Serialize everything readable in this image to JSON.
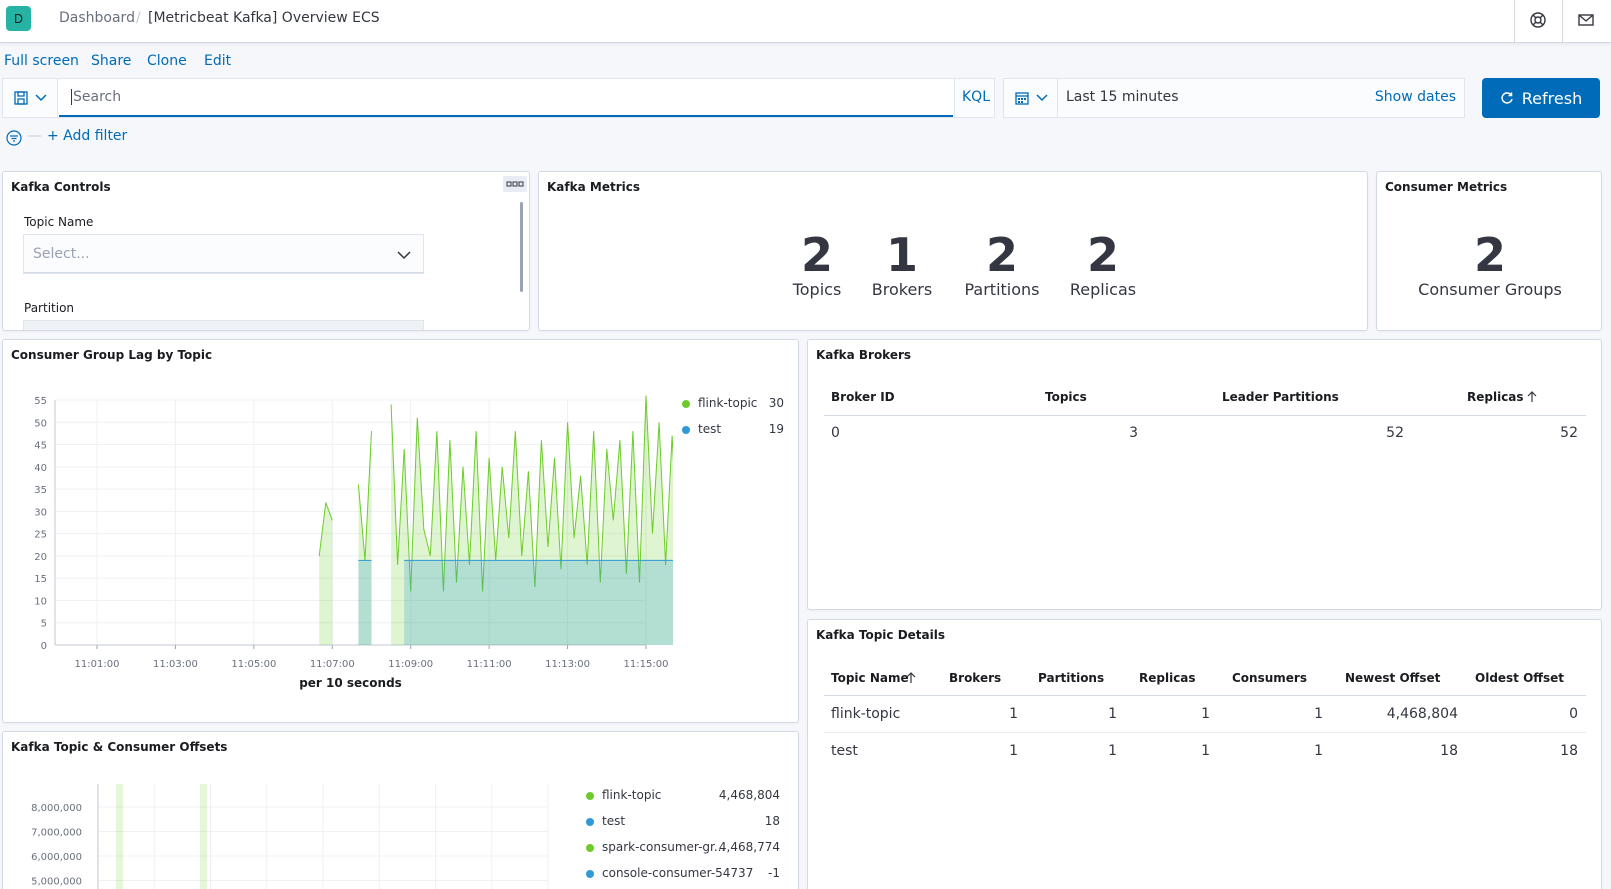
{
  "header": {
    "logo_letter": "D",
    "breadcrumb": [
      "Dashboard",
      "[Metricbeat Kafka] Overview ECS"
    ],
    "icons": [
      "help-icon",
      "mail-icon"
    ]
  },
  "menu": [
    "Full screen",
    "Share",
    "Clone",
    "Edit"
  ],
  "query": {
    "placeholder": "Search",
    "language": "KQL"
  },
  "time": {
    "range": "Last 15 minutes",
    "show_dates": "Show dates",
    "refresh": "Refresh"
  },
  "filter": {
    "add_filter": "+ Add filter"
  },
  "controls": {
    "title": "Kafka Controls",
    "topic_label": "Topic Name",
    "topic_placeholder": "Select...",
    "partition_label": "Partition"
  },
  "kafka_metrics": {
    "title": "Kafka Metrics",
    "items": [
      {
        "value": "2",
        "label": "Topics"
      },
      {
        "value": "1",
        "label": "Brokers"
      },
      {
        "value": "2",
        "label": "Partitions"
      },
      {
        "value": "2",
        "label": "Replicas"
      }
    ]
  },
  "consumer_metrics": {
    "title": "Consumer Metrics",
    "value": "2",
    "label": "Consumer Groups"
  },
  "lag_chart": {
    "title": "Consumer Group Lag by Topic",
    "xlabel": "per 10 seconds",
    "legend": [
      {
        "name": "flink-topic",
        "value": "30",
        "color": "#54b399"
      },
      {
        "name": "test",
        "value": "19",
        "color": "#6092c0"
      }
    ]
  },
  "chart_data": [
    {
      "type": "area",
      "title": "Consumer Group Lag by Topic",
      "xlabel": "per 10 seconds",
      "ylabel": "",
      "ylim": [
        0,
        55
      ],
      "yticks": [
        0,
        5,
        10,
        15,
        20,
        25,
        30,
        35,
        40,
        45,
        50,
        55
      ],
      "xticks": [
        "11:01:00",
        "11:03:00",
        "11:05:00",
        "11:07:00",
        "11:09:00",
        "11:11:00",
        "11:13:00",
        "11:15:00"
      ],
      "x_start_seconds_from_1100": 0,
      "x_step_seconds": 10,
      "series": [
        {
          "name": "flink-topic",
          "color": "#6dcc2b",
          "values": [
            null,
            null,
            null,
            null,
            null,
            null,
            null,
            null,
            null,
            null,
            null,
            null,
            null,
            null,
            null,
            null,
            null,
            null,
            null,
            null,
            null,
            null,
            null,
            null,
            null,
            null,
            null,
            null,
            null,
            null,
            null,
            null,
            null,
            null,
            null,
            null,
            null,
            null,
            null,
            null,
            20,
            32,
            28,
            null,
            null,
            null,
            36,
            19,
            48,
            null,
            null,
            54,
            18,
            44,
            12,
            51,
            26,
            20,
            48,
            12,
            46,
            14,
            40,
            18,
            48,
            12,
            42,
            19,
            40,
            24,
            48,
            20,
            39,
            13,
            46,
            22,
            42,
            17,
            50,
            24,
            38,
            18,
            48,
            14,
            44,
            28,
            46,
            16,
            48,
            14,
            56,
            25,
            50,
            18,
            47,
            20,
            52,
            16,
            40,
            18,
            52,
            21,
            48,
            22,
            44,
            15,
            50,
            24,
            42,
            18,
            46,
            20,
            54,
            22,
            48,
            14,
            55,
            24,
            48,
            11,
            52,
            22,
            50,
            14,
            50,
            30
          ]
        },
        {
          "name": "test",
          "color": "#2f9ad6",
          "values": [
            null,
            null,
            null,
            null,
            null,
            null,
            null,
            null,
            null,
            null,
            null,
            null,
            null,
            null,
            null,
            null,
            null,
            null,
            null,
            null,
            null,
            null,
            null,
            null,
            null,
            null,
            null,
            null,
            null,
            null,
            null,
            null,
            null,
            null,
            null,
            null,
            null,
            null,
            null,
            null,
            null,
            null,
            null,
            null,
            null,
            null,
            19,
            19,
            19,
            null,
            null,
            null,
            null,
            19,
            19,
            19,
            19,
            19,
            19,
            19,
            19,
            19,
            19,
            19,
            19,
            19,
            19,
            19,
            19,
            19,
            19,
            19,
            19,
            19,
            19,
            19,
            19,
            19,
            19,
            19,
            19,
            19,
            19,
            19,
            19,
            19,
            19,
            19,
            19,
            19,
            19,
            19,
            19,
            19,
            19,
            19,
            19,
            19,
            19,
            19,
            19,
            19,
            19,
            19,
            19,
            19,
            19,
            19,
            19,
            19,
            19,
            19,
            19,
            19,
            19,
            19,
            19,
            19,
            19,
            19,
            19,
            19,
            19,
            19,
            19,
            19
          ]
        }
      ]
    },
    {
      "type": "area",
      "title": "Kafka Topic & Consumer Offsets",
      "yticks": [
        "5,000,000",
        "6,000,000",
        "7,000,000",
        "8,000,000"
      ],
      "series": [
        {
          "name": "flink-topic",
          "value": "4,468,804"
        },
        {
          "name": "test",
          "value": "18"
        },
        {
          "name": "spark-consumer-gr...",
          "value": "4,468,774"
        },
        {
          "name": "console-consumer-54737",
          "value": "-1"
        }
      ]
    }
  ],
  "brokers": {
    "title": "Kafka Brokers",
    "columns": [
      "Broker ID",
      "Topics",
      "Leader Partitions",
      "Replicas"
    ],
    "rows": [
      [
        "0",
        "3",
        "52",
        "52"
      ]
    ]
  },
  "topic_details": {
    "title": "Kafka Topic Details",
    "columns": [
      "Topic Name",
      "Brokers",
      "Partitions",
      "Replicas",
      "Consumers",
      "Newest Offset",
      "Oldest Offset"
    ],
    "rows": [
      [
        "flink-topic",
        "1",
        "1",
        "1",
        "1",
        "4,468,804",
        "0"
      ],
      [
        "test",
        "1",
        "1",
        "1",
        "1",
        "18",
        "18"
      ]
    ]
  },
  "offsets": {
    "title": "Kafka Topic & Consumer Offsets",
    "yticks": [
      "8,000,000",
      "7,000,000",
      "6,000,000",
      "5,000,000"
    ],
    "legend": [
      {
        "name": "flink-topic",
        "value": "4,468,804",
        "color": "#6dcc2b"
      },
      {
        "name": "test",
        "value": "18",
        "color": "#2f9ad6"
      },
      {
        "name": "spark-consumer-gr...",
        "value": "4,468,774",
        "color": "#6dcc2b"
      },
      {
        "name": "console-consumer-54737",
        "value": "-1",
        "color": "#2f9ad6"
      }
    ]
  }
}
